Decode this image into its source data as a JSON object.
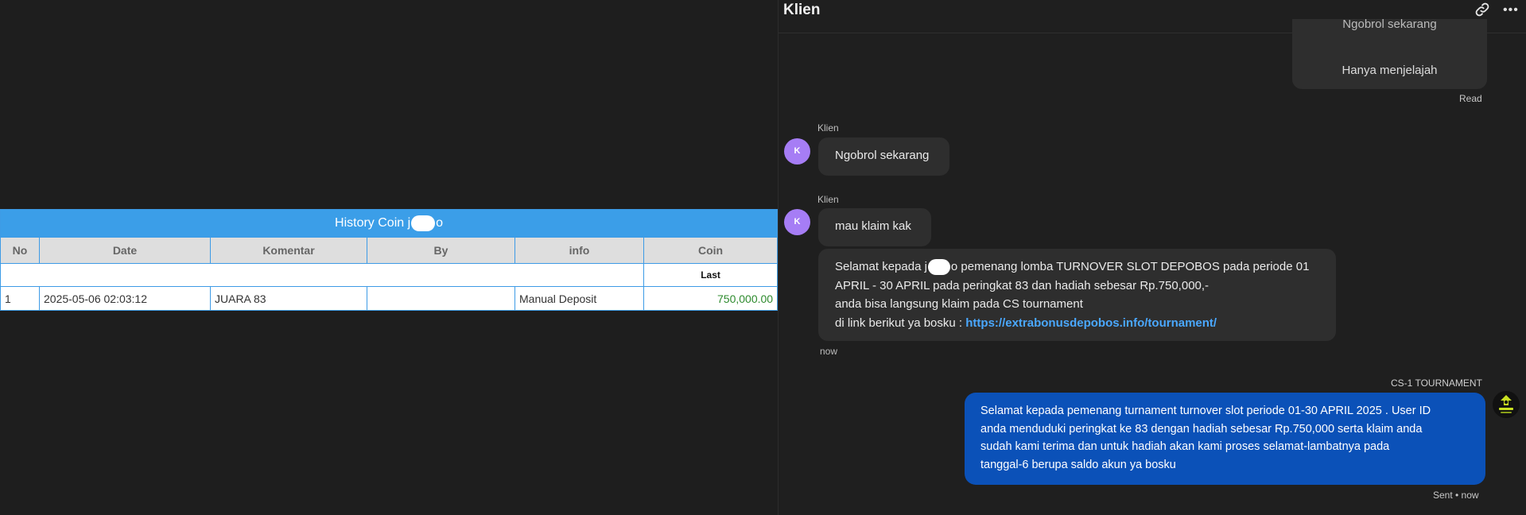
{
  "history": {
    "title_prefix": "History Coin j",
    "title_suffix": "o",
    "columns": [
      "No",
      "Date",
      "Komentar",
      "By",
      "info",
      "Coin"
    ],
    "sub_label": "Last",
    "rows": [
      {
        "no": "1",
        "date": "2025-05-06 02:03:12",
        "komentar": "JUARA 83",
        "by": "",
        "info": "Manual Deposit",
        "coin": "750,000.00"
      }
    ]
  },
  "chat": {
    "title": "Klien",
    "options": [
      "Ngobrol sekarang",
      "Hanya menjelajah"
    ],
    "read_label": "Read",
    "sender_name": "Klien",
    "avatar_initial": "K",
    "messages": {
      "m2": "Ngobrol sekarang",
      "m3": "mau klaim kak",
      "m4_line1_prefix": "Selamat kepada j",
      "m4_line1_suffix": "o pemenang lomba TURNOVER SLOT DEPOBOS pada periode 01",
      "m4_line2": "APRIL - 30 APRIL pada peringkat 83 dan hadiah sebesar Rp.750,000,-",
      "m4_line3": "anda bisa langsung klaim pada CS tournament",
      "m4_line4_prefix": "di link berikut ya bosku : ",
      "m4_link": "https://extrabonusdepobos.info/tournament/"
    },
    "now_label": "now",
    "agent_name": "CS-1 TOURNAMENT",
    "outgoing_lines": [
      "Selamat kepada pemenang turnament turnover slot periode 01-30 APRIL 2025 . User ID",
      "anda menduduki peringkat ke 83 dengan hadiah sebesar Rp.750,000 serta klaim anda",
      "sudah kami terima dan untuk hadiah akan kami proses selamat-lambatnya pada",
      "tanggal-6 berupa saldo akun ya bosku"
    ],
    "sent_status": "Sent • now",
    "icons": {
      "link": "link-icon",
      "more": "more-icon",
      "bot_avatar": "depobos-logo-icon"
    },
    "colors": {
      "accent": "#3b9ee8",
      "outgoing": "#0b51b8",
      "avatar": "#a67df5",
      "link": "#4aa8ff"
    }
  }
}
